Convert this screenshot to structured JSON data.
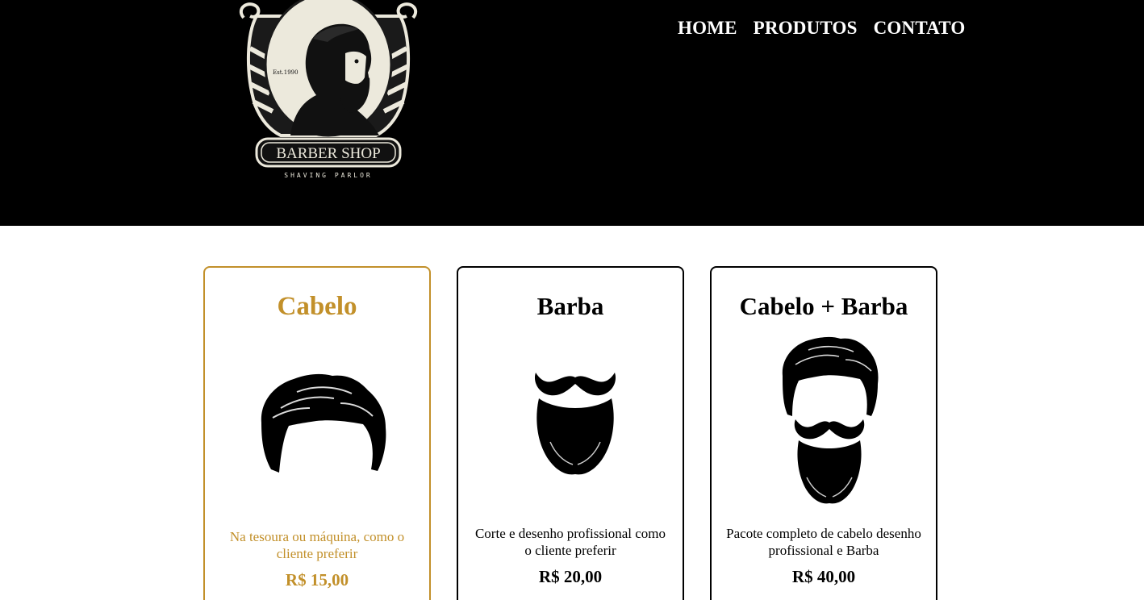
{
  "header": {
    "logo": {
      "icon": "barbershop-logo",
      "established": "Est.1990",
      "name": "BARBER SHOP",
      "tagline": "SHAVING PARLOR"
    },
    "nav": [
      {
        "label": "HOME"
      },
      {
        "label": "PRODUTOS"
      },
      {
        "label": "CONTATO"
      }
    ]
  },
  "cards": [
    {
      "title": "Cabelo",
      "icon": "hair-icon",
      "description": "Na tesoura ou máquina, como o cliente preferir",
      "price": "R$ 15,00"
    },
    {
      "title": "Barba",
      "icon": "beard-icon",
      "description": "Corte e desenho profissional como o cliente preferir",
      "price": "R$ 20,00"
    },
    {
      "title": "Cabelo + Barba",
      "icon": "hair-and-beard-icon",
      "description": "Pacote completo de cabelo desenho profissional e Barba",
      "price": "R$ 40,00"
    }
  ],
  "colors": {
    "accent": "#c2902a",
    "header_bg": "#000000",
    "logo_cream": "#ece9dc"
  }
}
